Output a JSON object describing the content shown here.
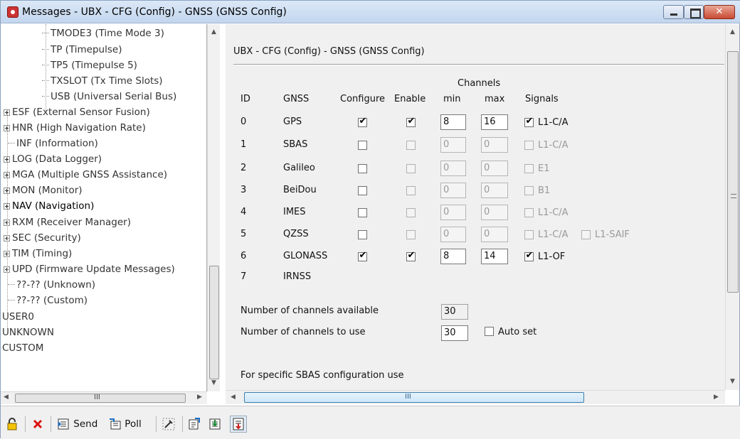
{
  "window": {
    "title": "Messages - UBX - CFG (Config) - GNSS (GNSS Config)"
  },
  "tree": {
    "items": [
      {
        "label": "TMODE3 (Time Mode 3)",
        "expandable": false,
        "indent": 3
      },
      {
        "label": "TP (Timepulse)",
        "expandable": false,
        "indent": 3
      },
      {
        "label": "TP5 (Timepulse 5)",
        "expandable": false,
        "indent": 3
      },
      {
        "label": "TXSLOT (Tx Time Slots)",
        "expandable": false,
        "indent": 3
      },
      {
        "label": "USB (Universal Serial Bus)",
        "expandable": false,
        "indent": 3
      },
      {
        "label": "ESF (External Sensor Fusion)",
        "expandable": true,
        "indent": 1
      },
      {
        "label": "HNR (High Navigation Rate)",
        "expandable": true,
        "indent": 1
      },
      {
        "label": "INF (Information)",
        "expandable": false,
        "indent": 1
      },
      {
        "label": "LOG (Data Logger)",
        "expandable": true,
        "indent": 1
      },
      {
        "label": "MGA (Multiple GNSS Assistance)",
        "expandable": true,
        "indent": 1
      },
      {
        "label": "MON (Monitor)",
        "expandable": true,
        "indent": 1
      },
      {
        "label": "NAV (Navigation)",
        "expandable": true,
        "indent": 1
      },
      {
        "label": "RXM (Receiver Manager)",
        "expandable": true,
        "indent": 1
      },
      {
        "label": "SEC (Security)",
        "expandable": true,
        "indent": 1
      },
      {
        "label": "TIM (Timing)",
        "expandable": true,
        "indent": 1
      },
      {
        "label": "UPD (Firmware Update Messages)",
        "expandable": true,
        "indent": 1
      },
      {
        "label": "??-?? (Unknown)",
        "expandable": false,
        "indent": 1
      },
      {
        "label": "??-?? (Custom)",
        "expandable": false,
        "indent": 1
      },
      {
        "label": "USER0",
        "expandable": false,
        "indent": 0
      },
      {
        "label": "UNKNOWN",
        "expandable": false,
        "indent": 0
      },
      {
        "label": "CUSTOM",
        "expandable": false,
        "indent": 0
      }
    ],
    "scroll_h_mark": "III"
  },
  "pane": {
    "title": "UBX - CFG (Config) - GNSS (GNSS Config)",
    "headers": {
      "channels": "Channels",
      "id": "ID",
      "gnss": "GNSS",
      "configure": "Configure",
      "enable": "Enable",
      "min": "min",
      "max": "max",
      "signals": "Signals"
    },
    "rows": [
      {
        "id": "0",
        "gnss": "GPS",
        "configure": true,
        "enable": true,
        "enabled": true,
        "min": "8",
        "max": "16",
        "signals": [
          {
            "label": "L1-C/A",
            "checked": true
          }
        ]
      },
      {
        "id": "1",
        "gnss": "SBAS",
        "configure": false,
        "enable": false,
        "enabled": false,
        "min": "0",
        "max": "0",
        "signals": [
          {
            "label": "L1-C/A",
            "checked": false
          }
        ]
      },
      {
        "id": "2",
        "gnss": "Galileo",
        "configure": false,
        "enable": false,
        "enabled": false,
        "min": "0",
        "max": "0",
        "signals": [
          {
            "label": "E1",
            "checked": false
          }
        ]
      },
      {
        "id": "3",
        "gnss": "BeiDou",
        "configure": false,
        "enable": false,
        "enabled": false,
        "min": "0",
        "max": "0",
        "signals": [
          {
            "label": "B1",
            "checked": false
          }
        ]
      },
      {
        "id": "4",
        "gnss": "IMES",
        "configure": false,
        "enable": false,
        "enabled": false,
        "min": "0",
        "max": "0",
        "signals": [
          {
            "label": "L1-C/A",
            "checked": false
          }
        ]
      },
      {
        "id": "5",
        "gnss": "QZSS",
        "configure": false,
        "enable": false,
        "enabled": false,
        "min": "0",
        "max": "0",
        "signals": [
          {
            "label": "L1-C/A",
            "checked": false
          },
          {
            "label": "L1-SAIF",
            "checked": false
          }
        ]
      },
      {
        "id": "6",
        "gnss": "GLONASS",
        "configure": true,
        "enable": true,
        "enabled": true,
        "min": "8",
        "max": "14",
        "signals": [
          {
            "label": "L1-OF",
            "checked": true
          }
        ]
      },
      {
        "id": "7",
        "gnss": "IRNSS",
        "configure": null,
        "enable": null,
        "enabled": false,
        "min": null,
        "max": null,
        "signals": []
      }
    ],
    "channels_available_label": "Number of channels available",
    "channels_available": "30",
    "channels_to_use_label": "Number of channels to use",
    "channels_to_use": "30",
    "auto_set_label": "Auto set",
    "auto_set": false,
    "sbas_note": "For specific SBAS configuration use",
    "scroll_h_mark": "III"
  },
  "toolbar": {
    "send_label": "Send",
    "poll_label": "Poll"
  }
}
